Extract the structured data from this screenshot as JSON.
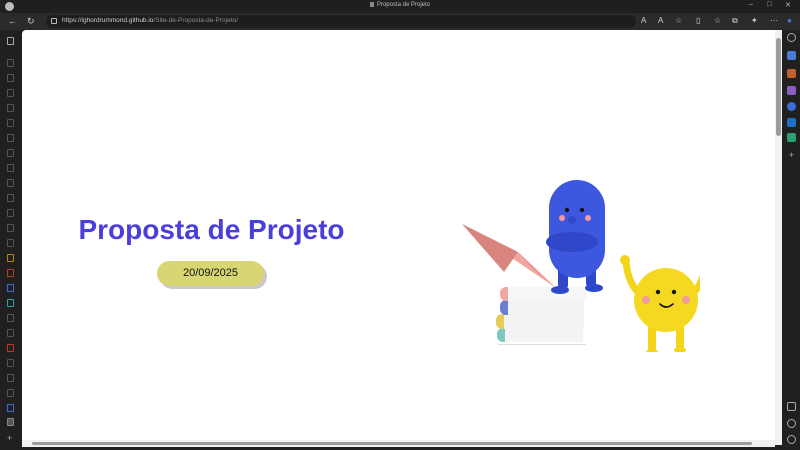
{
  "browser": {
    "window_title": "Proposta de Projeto",
    "url_host": "https://ighordrummond.github.io",
    "url_path": "/Site-de-Proposta-de-Projeto/",
    "theme": {
      "chrome_bg": "#202020",
      "address_bg": "#2b2b2b",
      "text": "#cfcfcf"
    }
  },
  "page": {
    "title": "Proposta de Projeto",
    "date": "20/09/2025",
    "colors": {
      "title": "#4b3fdc",
      "date_pill": "#d8d672",
      "background": "#ffffff"
    },
    "illustration_icon": "blue-and-yellow-characters-on-books-with-paper-plane"
  }
}
